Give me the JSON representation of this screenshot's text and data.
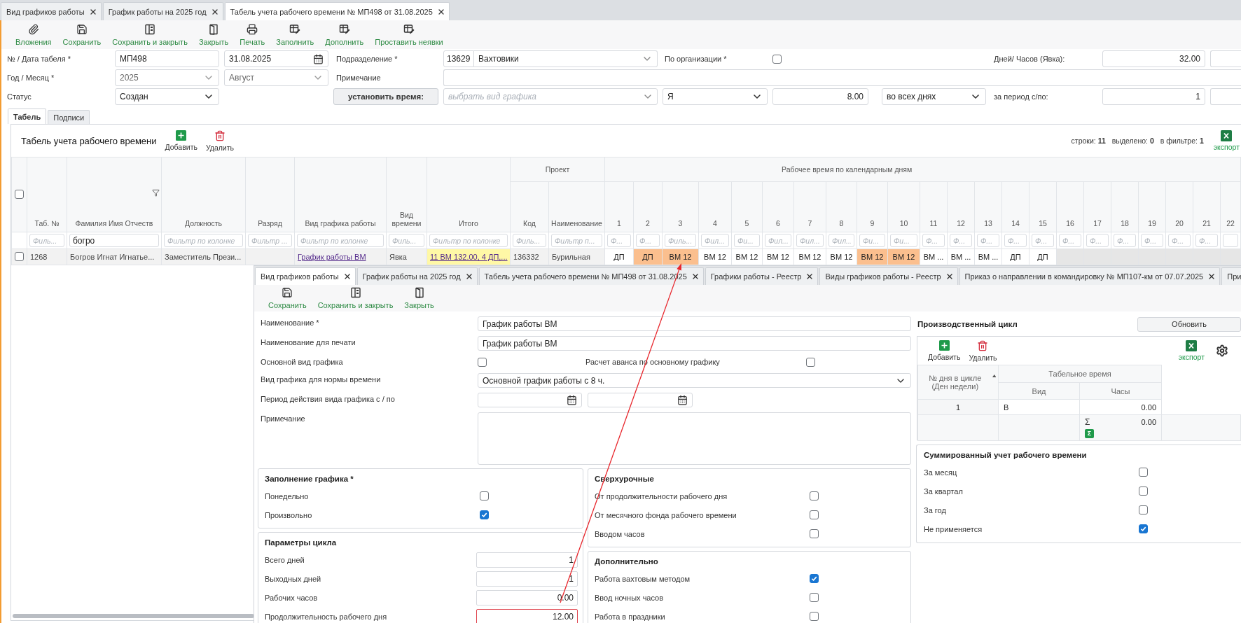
{
  "main_tabs": [
    {
      "label": "Вид графиков работы",
      "selected": false
    },
    {
      "label": "График работы на 2025 год",
      "selected": false
    },
    {
      "label": "Табель учета рабочего времени № МП498 от 31.08.2025",
      "selected": true
    }
  ],
  "main_toolbar": [
    {
      "kind": "attach",
      "label": "Вложения"
    },
    {
      "kind": "save",
      "label": "Сохранить"
    },
    {
      "kind": "save-close",
      "label": "Сохранить и закрыть"
    },
    {
      "kind": "close",
      "label": "Закрыть"
    },
    {
      "kind": "print",
      "label": "Печать"
    },
    {
      "kind": "fill",
      "label": "Заполнить"
    },
    {
      "kind": "fill",
      "label": "Дополнить"
    },
    {
      "kind": "fill",
      "label": "Проставить неявки"
    }
  ],
  "header_form": {
    "number_date": {
      "label": "№ / Дата табеля *",
      "number": "МП498",
      "date": "31.08.2025"
    },
    "division": {
      "label": "Подразделение *",
      "code": "13629",
      "name": "Вахтовики"
    },
    "by_organization": {
      "label": "По организации *",
      "checked": false
    },
    "attendance": {
      "label": "Дней/ Часов (Явка):",
      "value": "32.00"
    },
    "year_month": {
      "label": "Год / Месяц *",
      "year": "2025",
      "month": "Август",
      "disabled": true
    },
    "note": {
      "label": "Примечание"
    },
    "status": {
      "label": "Статус",
      "value": "Создан"
    },
    "set_time": {
      "button": "установить время:",
      "schedule": {
        "placeholder": "выбрать вид графика"
      },
      "time_kind": "Я",
      "hours": "8.00",
      "days_mode": "во всех днях"
    },
    "period": {
      "label": "за период с/по:",
      "from": "1"
    }
  },
  "sheet_tabs": [
    {
      "label": "Табель",
      "selected": true
    },
    {
      "label": "Подписи",
      "selected": false
    }
  ],
  "timesheet": {
    "title": "Табель учета рабочего времени",
    "actions": [
      {
        "kind": "add",
        "label": "Добавить"
      },
      {
        "kind": "delete",
        "label": "Удалить"
      }
    ],
    "stats": [
      {
        "label": "строки:",
        "value": "11"
      },
      {
        "label": "выделено:",
        "value": "0"
      },
      {
        "label": "в фильтре:",
        "value": "1"
      }
    ],
    "export": "экспорт",
    "select_all": {
      "checked": false
    },
    "columns": [
      {
        "label": "Таб. №",
        "filtered": false,
        "filter": {
          "placeholder": "Филь..."
        }
      },
      {
        "label": "Фамилия Имя Отчеств",
        "filtered": true,
        "filter": {
          "value": "богро"
        }
      },
      {
        "label": "Должность",
        "filtered": false,
        "filter": {
          "placeholder": "Фильтр по колонке"
        }
      },
      {
        "label": "Разряд",
        "filtered": false,
        "filter": {
          "placeholder": "Фильтр ..."
        }
      },
      {
        "label": "Вид графика работы",
        "filtered": false,
        "filter": {
          "placeholder": "Фильтр по колонке"
        }
      },
      {
        "label": "Вид времени",
        "filtered": false,
        "filter": {
          "placeholder": "Филь..."
        }
      },
      {
        "label": "Итого",
        "filtered": false,
        "filter": {
          "placeholder": "Фильтр по колонке"
        }
      }
    ],
    "project": {
      "label": "Проект",
      "columns": [
        {
          "label": "Код",
          "filtered": false,
          "filter": {
            "placeholder": "Филь..."
          }
        },
        {
          "label": "Наименование",
          "filtered": false,
          "filter": {
            "placeholder": "Фильтр п..."
          }
        }
      ]
    },
    "calendar": {
      "label": "Рабочее время по календарным дням",
      "days": [
        {
          "label": "1",
          "filter": {
            "placeholder": "Ф..."
          }
        },
        {
          "label": "2",
          "filter": {
            "placeholder": "Ф..."
          }
        },
        {
          "label": "3",
          "filter": {
            "placeholder": "Филь..."
          }
        },
        {
          "label": "4",
          "filter": {
            "placeholder": "Фил..."
          }
        },
        {
          "label": "5",
          "filter": {
            "placeholder": "Фи..."
          }
        },
        {
          "label": "6",
          "filter": {
            "placeholder": "Фил..."
          }
        },
        {
          "label": "7",
          "filter": {
            "placeholder": "Фил..."
          }
        },
        {
          "label": "8",
          "filter": {
            "placeholder": "Фил..."
          }
        },
        {
          "label": "9",
          "filter": {
            "placeholder": "Фи..."
          }
        },
        {
          "label": "10",
          "filter": {
            "placeholder": "Фи..."
          }
        },
        {
          "label": "11",
          "filter": {
            "placeholder": "Ф..."
          }
        },
        {
          "label": "12",
          "filter": {
            "placeholder": "Ф..."
          }
        },
        {
          "label": "13",
          "filter": {
            "placeholder": "Ф..."
          }
        },
        {
          "label": "14",
          "filter": {
            "placeholder": "Ф..."
          }
        },
        {
          "label": "15",
          "filter": {
            "placeholder": "Ф..."
          }
        },
        {
          "label": "16",
          "filter": {
            "placeholder": "Ф..."
          }
        },
        {
          "label": "17",
          "filter": {
            "placeholder": "Ф..."
          }
        },
        {
          "label": "18",
          "filter": {
            "placeholder": "Ф..."
          }
        },
        {
          "label": "19",
          "filter": {
            "placeholder": "Ф..."
          }
        },
        {
          "label": "20",
          "filter": {
            "placeholder": "Ф..."
          }
        },
        {
          "label": "21",
          "filter": {
            "placeholder": "Ф..."
          }
        },
        {
          "label": "22"
        }
      ]
    },
    "rows": [
      {
        "selected": false,
        "cells": [
          {
            "kind": "text",
            "text": "1268"
          },
          {
            "kind": "text",
            "text": "Богров Игнат Игнатье..."
          },
          {
            "kind": "text",
            "text": "Заместитель Прези..."
          },
          {
            "kind": "empty"
          },
          {
            "kind": "link",
            "text": "График работы ВМ"
          },
          {
            "kind": "text",
            "text": "Явка"
          },
          {
            "kind": "summary",
            "text": "11 ВМ 132.00, 4 ДП,..."
          },
          {
            "kind": "text",
            "text": "136332"
          },
          {
            "kind": "text",
            "text": "Бурильная"
          }
        ],
        "days": [
          {
            "value": "ДП",
            "highlighted": false
          },
          {
            "value": "ДП",
            "highlighted": true
          },
          {
            "value": "ВМ 12",
            "highlighted": true
          },
          {
            "value": "ВМ 12",
            "highlighted": false
          },
          {
            "value": "ВМ 12",
            "highlighted": false
          },
          {
            "value": "ВМ 12",
            "highlighted": false
          },
          {
            "value": "ВМ 12",
            "highlighted": false
          },
          {
            "value": "ВМ 12",
            "highlighted": false
          },
          {
            "value": "ВМ 12",
            "highlighted": true
          },
          {
            "value": "ВМ 12",
            "highlighted": true
          },
          {
            "value": "ВМ ...",
            "highlighted": false
          },
          {
            "value": "ВМ ...",
            "highlighted": false
          },
          {
            "value": "ВМ ...",
            "highlighted": false
          },
          {
            "value": "ДП",
            "highlighted": false
          },
          {
            "value": "ДП",
            "highlighted": false
          }
        ]
      }
    ]
  },
  "schedule_window": {
    "tabs": [
      {
        "label": "Вид графиков работы",
        "selected": true,
        "closable": true
      },
      {
        "label": "График работы на 2025 год",
        "selected": false,
        "closable": true
      },
      {
        "label": "Табель учета рабочего времени № МП498 от 31.08.2025",
        "selected": false,
        "closable": true
      },
      {
        "label": "Графики работы - Реестр",
        "selected": false,
        "closable": true
      },
      {
        "label": "Виды графиков работы - Реестр",
        "selected": false,
        "closable": true
      },
      {
        "label": "Приказ о направлении в командировку № МП107-км от 07.07.2025",
        "selected": false,
        "closable": true
      },
      {
        "label": "При",
        "selected": false,
        "closable": false
      }
    ],
    "toolbar": [
      {
        "kind": "save",
        "label": "Сохранить"
      },
      {
        "kind": "save-close",
        "label": "Сохранить и закрыть"
      },
      {
        "kind": "close",
        "label": "Закрыть"
      }
    ],
    "fields": [
      {
        "kind": "text",
        "label": "Наименование *",
        "value": "График работы ВМ"
      },
      {
        "kind": "text",
        "label": "Наименование для печати",
        "value": "График работы ВМ"
      },
      {
        "kind": "checks",
        "label": "Основной вид графика",
        "checked": false,
        "extra_label": "Расчет аванса по основному графику",
        "extra_checked": false
      },
      {
        "kind": "select",
        "label": "Вид графика для нормы времени",
        "value": "Основной график работы с 8 ч."
      },
      {
        "kind": "dates",
        "label": "Период действия вида графика с / по"
      },
      {
        "kind": "textarea",
        "label": "Примечание"
      }
    ],
    "left_sections": [
      {
        "title": "Заполнение графика *",
        "items": [
          {
            "kind": "checkbox",
            "label": "Понедельно",
            "checked": false
          },
          {
            "kind": "checkbox",
            "label": "Произвольно",
            "checked": true
          }
        ]
      },
      {
        "title": "Параметры цикла",
        "items": [
          {
            "kind": "number",
            "label": "Всего дней",
            "value": "1",
            "invalid": false
          },
          {
            "kind": "number",
            "label": "Выходных дней",
            "value": "1",
            "invalid": false
          },
          {
            "kind": "number",
            "label": "Рабочих часов",
            "value": "0.00",
            "invalid": false
          },
          {
            "kind": "number",
            "label": "Продолжительность рабочего дня",
            "value": "12.00",
            "invalid": true
          }
        ]
      }
    ],
    "middle_sections": [
      {
        "title": "Сверхурочные",
        "items": [
          {
            "kind": "checkbox",
            "label": "От продолжительности рабочего дня",
            "checked": false
          },
          {
            "kind": "checkbox",
            "label": "От месячного фонда рабочего времени",
            "checked": false
          },
          {
            "kind": "checkbox",
            "label": "Вводом часов",
            "checked": false
          }
        ]
      },
      {
        "title": "Дополнительно",
        "items": [
          {
            "kind": "checkbox",
            "label": "Работа вахтовым методом",
            "checked": true
          },
          {
            "kind": "checkbox",
            "label": "Ввод ночных часов",
            "checked": false
          },
          {
            "kind": "checkbox",
            "label": "Работа в праздники",
            "checked": false
          }
        ]
      }
    ],
    "production_cycle": {
      "title": "Производственный цикл",
      "refresh": "Обновить",
      "actions": [
        {
          "kind": "add",
          "label": "Добавить"
        },
        {
          "kind": "delete",
          "label": "Удалить"
        }
      ],
      "export": "экспорт",
      "group": "Табельное время",
      "columns": [
        {
          "label": "№ дня в цикле (Ден недели)",
          "sorted": true
        },
        {
          "label": "Вид",
          "sorted": false
        },
        {
          "label": "Часы",
          "sorted": false
        }
      ],
      "rows": [
        {
          "cells": [
            "1",
            "В",
            "0.00"
          ]
        }
      ],
      "total_sign": "Σ",
      "total": "0.00",
      "sum_button": "Σ"
    },
    "summed": {
      "title": "Суммированный учет рабочего времени",
      "items": [
        {
          "label": "За месяц",
          "checked": false
        },
        {
          "label": "За квартал",
          "checked": false
        },
        {
          "label": "За год",
          "checked": false
        },
        {
          "label": "Не применяется",
          "checked": true
        }
      ]
    }
  }
}
